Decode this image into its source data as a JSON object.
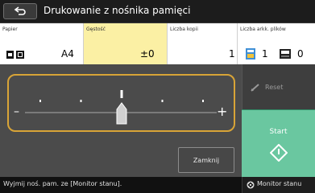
{
  "header": {
    "title": "Drukowanie z nośnika pamięci"
  },
  "settings": {
    "paper": {
      "label": "Papier",
      "value": "A4",
      "icons": [
        "paper-tray-icon",
        "paper-source-icon"
      ]
    },
    "density": {
      "label": "Gęstość",
      "value": "±0"
    },
    "copies": {
      "label": "Liczba kopii",
      "value": "1"
    },
    "sheets": {
      "label": "Liczba arkk. plików",
      "file_count": "1",
      "page_count": "0",
      "icons": [
        "file-icon",
        "page-icon"
      ]
    }
  },
  "slider": {
    "level": 0,
    "min": -4,
    "max": 4,
    "minus_label": "–",
    "plus_label": "+"
  },
  "buttons": {
    "reset": "Reset",
    "close": "Zamknij",
    "start": "Start"
  },
  "status": {
    "message": "Wyjmij noś. pam. ze [Monitor stanu].",
    "monitor": "Monitor stanu"
  },
  "colors": {
    "accent_border": "#d8a437",
    "start_green": "#6ac7a0",
    "highlight_yellow": "#fbf0a4"
  }
}
